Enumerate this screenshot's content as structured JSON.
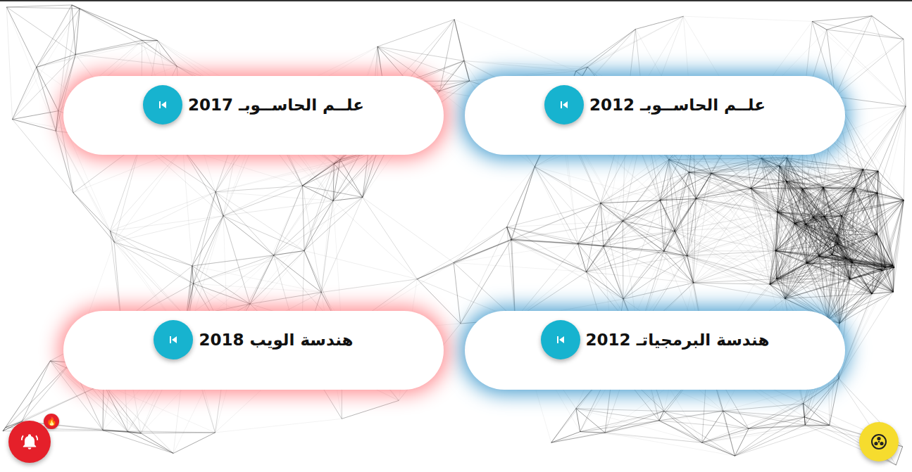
{
  "cards": [
    {
      "title": "علــم الحاســوبـ 2012",
      "color": "#4a9fd0"
    },
    {
      "title": "علــم الحاســوبـ 2017",
      "color": "#ff8a8f"
    },
    {
      "title": "هندسة البرمجياتـ 2012",
      "color": "#4a9fd0"
    },
    {
      "title": "هندسة الويب 2018",
      "color": "#ff8a8f"
    }
  ],
  "notifications": {
    "badge": "🔥"
  }
}
